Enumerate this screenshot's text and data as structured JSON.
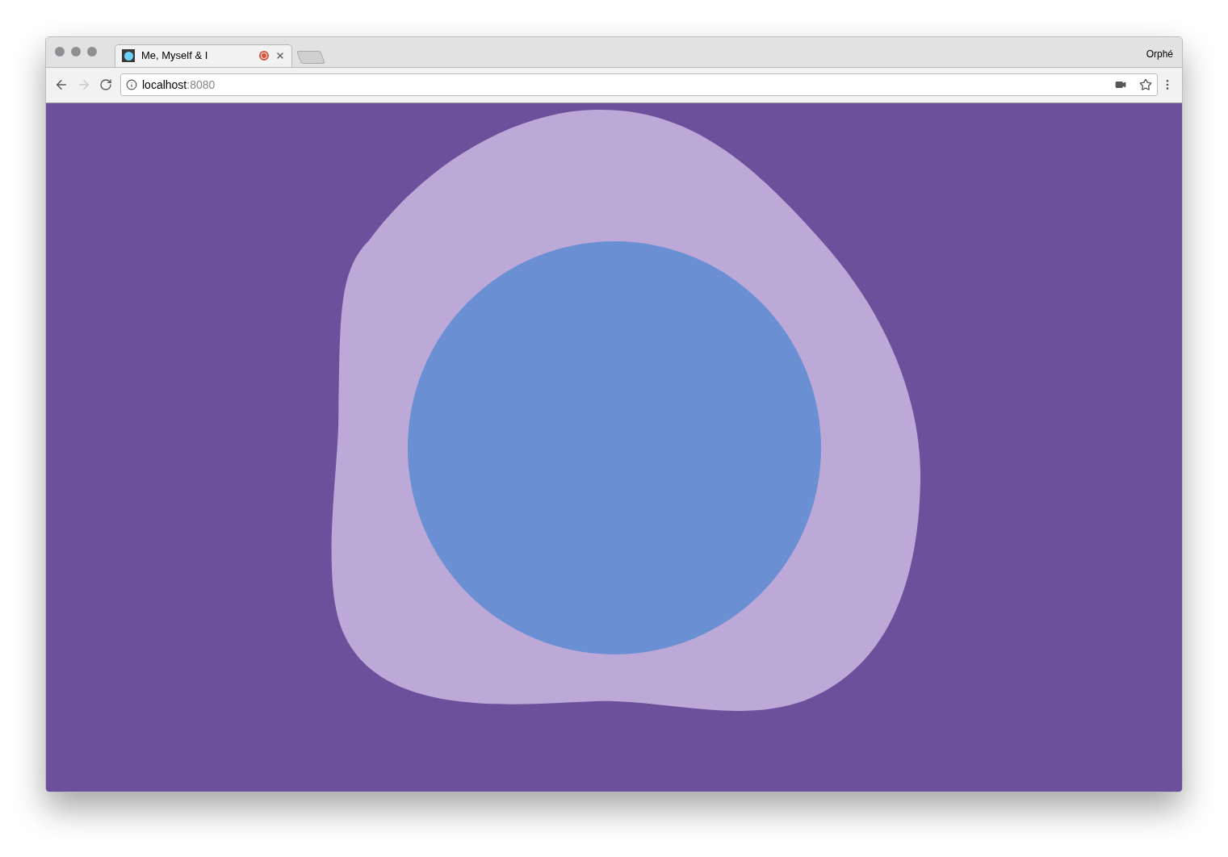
{
  "tab": {
    "title": "Me, Myself & I"
  },
  "profile": {
    "name": "Orphé"
  },
  "address": {
    "host": "localhost",
    "port": ":8080"
  }
}
